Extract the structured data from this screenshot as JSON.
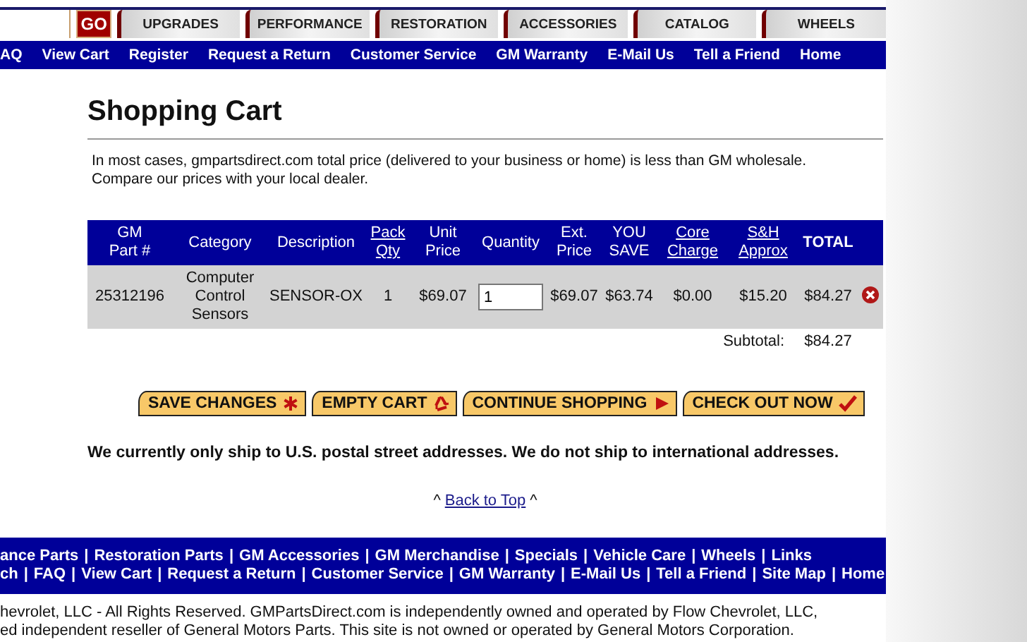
{
  "search": {
    "button": "GO"
  },
  "tabs": [
    {
      "label": "UPGRADES"
    },
    {
      "label": "PERFORMANCE"
    },
    {
      "label": "RESTORATION"
    },
    {
      "label": "ACCESSORIES"
    },
    {
      "label": "CATALOG"
    },
    {
      "label": "WHEELS"
    }
  ],
  "nav": [
    "AQ",
    "View Cart",
    "Register",
    "Request a Return",
    "Customer Service",
    "GM Warranty",
    "E-Mail Us",
    "Tell a Friend",
    "Home"
  ],
  "title": "Shopping Cart",
  "intro": "In most cases, gmpartsdirect.com total price (delivered to your business or home) is less than GM wholesale. Compare our prices with your local dealer.",
  "table": {
    "columns": [
      {
        "label": "GM\nPart #",
        "link": false
      },
      {
        "label": "Category",
        "link": false
      },
      {
        "label": "Description",
        "link": false
      },
      {
        "label": "Pack\nQty",
        "link": true
      },
      {
        "label": "Unit\nPrice",
        "link": false
      },
      {
        "label": "Quantity",
        "link": false
      },
      {
        "label": "Ext.\nPrice",
        "link": false
      },
      {
        "label": "YOU\nSAVE",
        "link": false
      },
      {
        "label": "Core\nCharge",
        "link": true
      },
      {
        "label": "S&H\nApprox",
        "link": true
      },
      {
        "label": "TOTAL",
        "link": false
      }
    ],
    "rows": [
      {
        "part": "25312196",
        "category": "Computer Control Sensors",
        "description": "SENSOR-OX",
        "pack_qty": "1",
        "unit_price": "$69.07",
        "quantity": "1",
        "ext_price": "$69.07",
        "you_save": "$63.74",
        "core_charge": "$0.00",
        "sh_approx": "$15.20",
        "total": "$84.27"
      }
    ],
    "subtotal_label": "Subtotal:",
    "subtotal": "$84.27"
  },
  "buttons": [
    {
      "label": "SAVE CHANGES",
      "kind": "asterisk"
    },
    {
      "label": "EMPTY CART",
      "kind": "recycle"
    },
    {
      "label": "CONTINUE SHOPPING",
      "kind": "arrow"
    },
    {
      "label": "CHECK OUT NOW",
      "kind": "check"
    }
  ],
  "notice": "We currently only ship to U.S. postal street addresses. We do not ship to international addresses.",
  "back_to_top": {
    "before": "^",
    "link": "Back to Top",
    "after": "^"
  },
  "footer": {
    "separator": "|",
    "lines": [
      {
        "links": [
          "ance Parts",
          "Restoration Parts",
          "GM Accessories",
          "GM Merchandise",
          "Specials",
          "Vehicle Care",
          "Wheels",
          "Links"
        ]
      },
      {
        "links": [
          "ch",
          "FAQ",
          "View Cart",
          "Request a Return",
          "Customer Service",
          "GM Warranty",
          "E-Mail Us",
          "Tell a Friend",
          "Site Map",
          "Home"
        ]
      }
    ]
  },
  "copyright": [
    "hevrolet, LLC - All Rights Reserved. GMPartsDirect.com is independently owned and operated by Flow Chevrolet, LLC,",
    "ed independent reseller of General Motors Parts. This site is not owned or operated by General Motors Corporation."
  ]
}
